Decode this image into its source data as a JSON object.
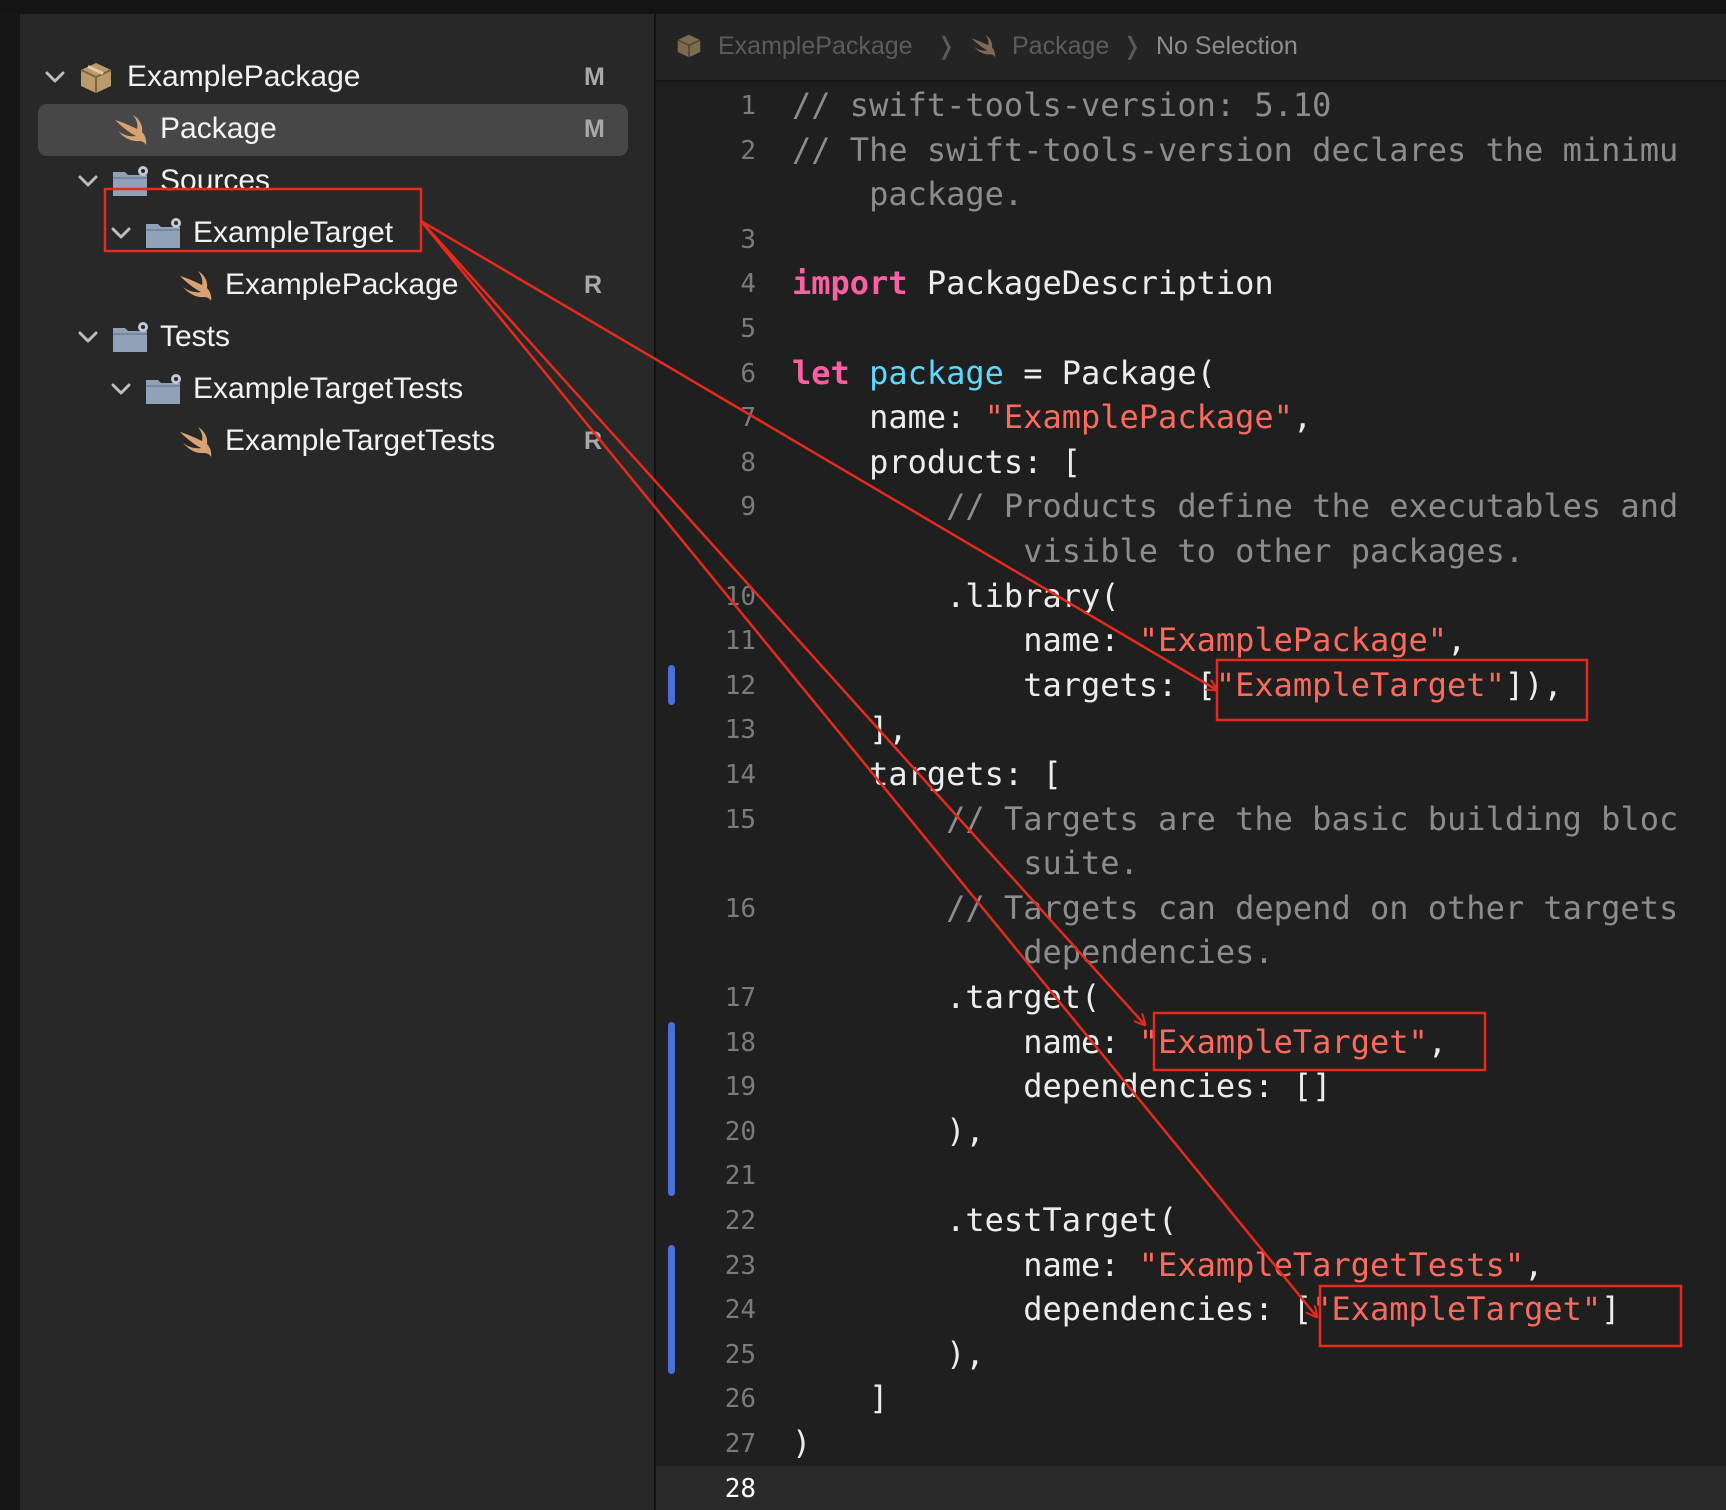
{
  "navigator": {
    "items": [
      {
        "label": "ExamplePackage",
        "badge": "M",
        "icon": "package-icon",
        "expanded": true
      },
      {
        "label": "Package",
        "badge": "M",
        "icon": "swift-file-icon",
        "selected": true
      },
      {
        "label": "Sources",
        "badge": "",
        "icon": "folder-icon",
        "expanded": true
      },
      {
        "label": "ExampleTarget",
        "badge": "",
        "icon": "folder-icon",
        "expanded": true
      },
      {
        "label": "ExamplePackage",
        "badge": "R",
        "icon": "swift-file-icon"
      },
      {
        "label": "Tests",
        "badge": "",
        "icon": "folder-icon",
        "expanded": true
      },
      {
        "label": "ExampleTargetTests",
        "badge": "",
        "icon": "folder-icon",
        "expanded": true
      },
      {
        "label": "ExampleTargetTests",
        "badge": "R",
        "icon": "swift-file-icon"
      }
    ]
  },
  "jumpbar": {
    "crumbs": [
      "ExamplePackage",
      "Package",
      "No Selection"
    ]
  },
  "editor": {
    "active_line": 28,
    "lines": [
      {
        "n": "1",
        "segs": [
          {
            "t": "// swift-tools-version: 5.10",
            "c": "comment"
          }
        ]
      },
      {
        "n": "2",
        "segs": [
          {
            "t": "// The swift-tools-version declares the minimu",
            "c": "comment"
          }
        ]
      },
      {
        "n": "",
        "segs": [
          {
            "t": "    package.",
            "c": "comment"
          }
        ]
      },
      {
        "n": "3",
        "segs": []
      },
      {
        "n": "4",
        "segs": [
          {
            "t": "import",
            "c": "kw"
          },
          {
            "t": " PackageDescription",
            "c": "plain"
          }
        ]
      },
      {
        "n": "5",
        "segs": []
      },
      {
        "n": "6",
        "segs": [
          {
            "t": "let",
            "c": "kw"
          },
          {
            "t": " ",
            "c": "plain"
          },
          {
            "t": "package",
            "c": "decl"
          },
          {
            "t": " = Package(",
            "c": "plain"
          }
        ]
      },
      {
        "n": "7",
        "segs": [
          {
            "t": "    name: ",
            "c": "plain"
          },
          {
            "t": "\"ExamplePackage\"",
            "c": "str"
          },
          {
            "t": ",",
            "c": "plain"
          }
        ]
      },
      {
        "n": "8",
        "segs": [
          {
            "t": "    products: [",
            "c": "plain"
          }
        ]
      },
      {
        "n": "9",
        "segs": [
          {
            "t": "        // Products define the executables and",
            "c": "comment"
          }
        ]
      },
      {
        "n": "",
        "segs": [
          {
            "t": "            visible to other packages.",
            "c": "comment"
          }
        ]
      },
      {
        "n": "10",
        "segs": [
          {
            "t": "        .library(",
            "c": "plain"
          }
        ]
      },
      {
        "n": "11",
        "segs": [
          {
            "t": "            name: ",
            "c": "plain"
          },
          {
            "t": "\"ExamplePackage\"",
            "c": "str"
          },
          {
            "t": ",",
            "c": "plain"
          }
        ]
      },
      {
        "n": "12",
        "segs": [
          {
            "t": "            targets: [",
            "c": "plain"
          },
          {
            "t": "\"ExampleTarget\"",
            "c": "str"
          },
          {
            "t": "]),",
            "c": "plain"
          }
        ]
      },
      {
        "n": "13",
        "segs": [
          {
            "t": "    ],",
            "c": "plain"
          }
        ]
      },
      {
        "n": "14",
        "segs": [
          {
            "t": "    targets: [",
            "c": "plain"
          }
        ]
      },
      {
        "n": "15",
        "segs": [
          {
            "t": "        // Targets are the basic building bloc",
            "c": "comment"
          }
        ]
      },
      {
        "n": "",
        "segs": [
          {
            "t": "            suite.",
            "c": "comment"
          }
        ]
      },
      {
        "n": "16",
        "segs": [
          {
            "t": "        // Targets can depend on other targets",
            "c": "comment"
          }
        ]
      },
      {
        "n": "",
        "segs": [
          {
            "t": "            dependencies.",
            "c": "comment"
          }
        ]
      },
      {
        "n": "17",
        "segs": [
          {
            "t": "        .target(",
            "c": "plain"
          }
        ]
      },
      {
        "n": "18",
        "segs": [
          {
            "t": "            name: ",
            "c": "plain"
          },
          {
            "t": "\"ExampleTarget\"",
            "c": "str"
          },
          {
            "t": ",",
            "c": "plain"
          }
        ]
      },
      {
        "n": "19",
        "segs": [
          {
            "t": "            dependencies: []",
            "c": "plain"
          }
        ]
      },
      {
        "n": "20",
        "segs": [
          {
            "t": "        ),",
            "c": "plain"
          }
        ]
      },
      {
        "n": "21",
        "segs": []
      },
      {
        "n": "22",
        "segs": [
          {
            "t": "        .testTarget(",
            "c": "plain"
          }
        ]
      },
      {
        "n": "23",
        "segs": [
          {
            "t": "            name: ",
            "c": "plain"
          },
          {
            "t": "\"ExampleTargetTests\"",
            "c": "str"
          },
          {
            "t": ",",
            "c": "plain"
          }
        ]
      },
      {
        "n": "24",
        "segs": [
          {
            "t": "            dependencies: [",
            "c": "plain"
          },
          {
            "t": "\"ExampleTarget\"",
            "c": "str"
          },
          {
            "t": "]",
            "c": "plain"
          }
        ]
      },
      {
        "n": "25",
        "segs": [
          {
            "t": "        ),",
            "c": "plain"
          }
        ]
      },
      {
        "n": "26",
        "segs": [
          {
            "t": "    ]",
            "c": "plain"
          }
        ]
      },
      {
        "n": "27",
        "segs": [
          {
            "t": ")",
            "c": "plain"
          }
        ]
      },
      {
        "n": "28",
        "segs": []
      }
    ]
  },
  "colors": {
    "annotation": "#e8291c",
    "change_bar": "#4b6fd6",
    "keyword": "#fc5fa3",
    "string": "#fc6a5d",
    "declaration": "#5dd8ff",
    "comment": "#8c8c8c"
  }
}
